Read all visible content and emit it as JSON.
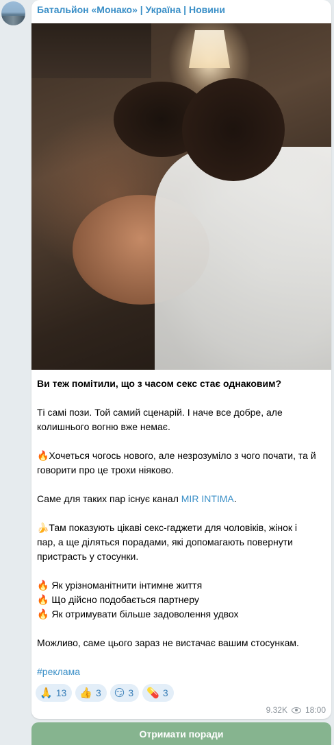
{
  "channel": {
    "name": "Батальйон «Монако» | Україна | Новини"
  },
  "post": {
    "headline": "Ви теж помітили, що з часом секс стає однаковим?",
    "line1": "Ті самі пози. Той самий сценарій. І наче все добре, але",
    "line2": "колишнього вогню вже немає.",
    "line3": "🔥Хочеться чогось нового, але незрозуміло з чого почати, та й",
    "line4": "говорити про це трохи ніяково.",
    "line5_prefix": "Саме для таких пар існує канал ",
    "line5_link": "MIR INTIMA",
    "line5_suffix": ".",
    "line6": "🍌Там показують цікаві секс-гаджети для чоловіків, жінок і",
    "line7": "пар, а ще діляться порадами, які допомагають повернути",
    "line8": "пристрасть у стосунки.",
    "bullet1": "🔥 Як урізноманітнити інтимне життя",
    "bullet2": "🔥 Що дійсно подобається партнеру",
    "bullet3": "🔥 Як отримувати більше задоволення удвох",
    "closing": "Можливо, саме цього зараз не вистачає вашим стосункам.",
    "hashtag": "#реклама"
  },
  "reactions": [
    {
      "emoji": "🙏",
      "count": "13"
    },
    {
      "emoji": "👍",
      "count": "3"
    },
    {
      "emoji": "😏",
      "count": "3"
    },
    {
      "emoji": "💊",
      "count": "3"
    }
  ],
  "meta": {
    "views": "9.32K",
    "time": "18:00"
  },
  "button": {
    "label": "Отримати поради"
  },
  "colors": {
    "link": "#3a8fc7",
    "button": "#86b48f",
    "background": "#e6ebee"
  }
}
